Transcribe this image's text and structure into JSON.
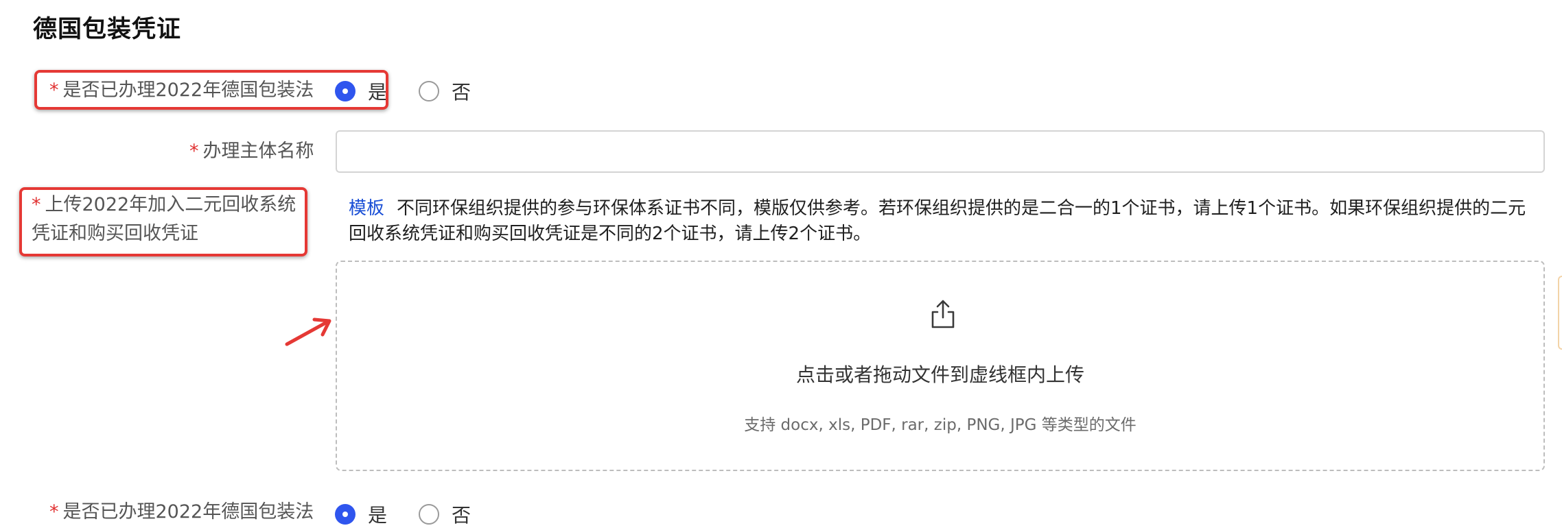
{
  "page": {
    "title": "德国包装凭证"
  },
  "form": {
    "required_mark": "*",
    "registered_question": {
      "label": "是否已办理2022年德国包装法",
      "options": [
        {
          "label": "是",
          "selected": true
        },
        {
          "label": "否",
          "selected": false
        }
      ]
    },
    "entity_name": {
      "label": "办理主体名称",
      "value": "",
      "placeholder": ""
    },
    "upload_certificates": {
      "label": "上传2022年加入二元回收系统凭证和购买回收凭证",
      "template_link": "模板",
      "note": "不同环保组织提供的参与环保体系证书不同，模版仅供参考。若环保组织提供的是二合一的1个证书，请上传1个证书。如果环保组织提供的二元回收系统凭证和购买回收凭证是不同的2个证书，请上传2个证书。",
      "dropzone_text": "点击或者拖动文件到虚线框内上传",
      "dropzone_hint": "支持 docx, xls, PDF, rar, zip, PNG, JPG 等类型的文件"
    },
    "second_registered_question": {
      "label": "是否已办理2022年德国包装法",
      "options": [
        {
          "label": "是",
          "selected": true
        },
        {
          "label": "否",
          "selected": false
        }
      ]
    }
  },
  "colors": {
    "accent": "#2f55ee",
    "required": "#e03131",
    "annotation": "#e53935",
    "link": "#1a4fd6"
  },
  "icons": {
    "upload": "upload-icon",
    "annotation_arrow": "arrow-icon"
  }
}
